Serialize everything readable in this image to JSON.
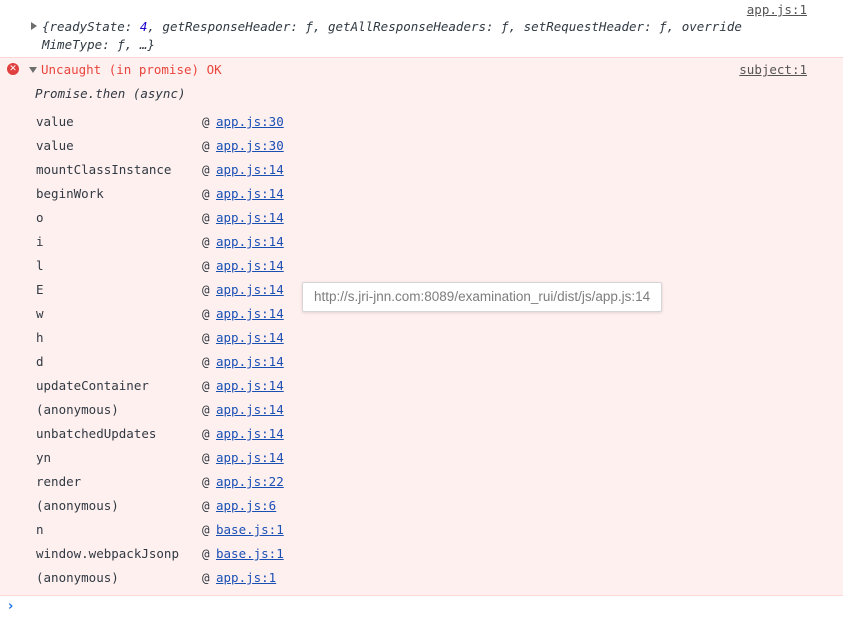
{
  "log": {
    "source": "app.js:1",
    "object_line1_prefix": "{readyState: ",
    "object_line1_number": "4",
    "object_line1_suffix": ", getResponseHeader: ƒ, getAllResponseHeaders: ƒ, setRequestHeader: ƒ, override",
    "object_line2": "MimeType: ƒ, …}"
  },
  "error": {
    "icon": "error-circle-icon",
    "message": "Uncaught (in promise) OK",
    "source": "subject:1",
    "async_label": "Promise.then (async)",
    "at_symbol": "@",
    "stack": [
      {
        "fn": "value",
        "loc": "app.js:30"
      },
      {
        "fn": "value",
        "loc": "app.js:30"
      },
      {
        "fn": "mountClassInstance",
        "loc": "app.js:14"
      },
      {
        "fn": "beginWork",
        "loc": "app.js:14"
      },
      {
        "fn": "o",
        "loc": "app.js:14"
      },
      {
        "fn": "i",
        "loc": "app.js:14"
      },
      {
        "fn": "l",
        "loc": "app.js:14"
      },
      {
        "fn": "E",
        "loc": "app.js:14"
      },
      {
        "fn": "w",
        "loc": "app.js:14"
      },
      {
        "fn": "h",
        "loc": "app.js:14"
      },
      {
        "fn": "d",
        "loc": "app.js:14"
      },
      {
        "fn": "updateContainer",
        "loc": "app.js:14"
      },
      {
        "fn": "(anonymous)",
        "loc": "app.js:14"
      },
      {
        "fn": "unbatchedUpdates",
        "loc": "app.js:14"
      },
      {
        "fn": "yn",
        "loc": "app.js:14"
      },
      {
        "fn": "render",
        "loc": "app.js:22"
      },
      {
        "fn": "(anonymous)",
        "loc": "app.js:6"
      },
      {
        "fn": "n",
        "loc": "base.js:1"
      },
      {
        "fn": "window.webpackJsonp",
        "loc": "base.js:1"
      },
      {
        "fn": "(anonymous)",
        "loc": "app.js:1"
      }
    ]
  },
  "tooltip": {
    "text": "http://s.jri-jnn.com:8089/examination_rui/dist/js/app.js:14"
  },
  "prompt": {
    "symbol": "›",
    "icon": "prompt-chevron-icon"
  },
  "colors": {
    "error_background": "#fff0f0",
    "error_text": "#e8453c",
    "link": "#1a4fb4",
    "prompt": "#1a73e8"
  }
}
